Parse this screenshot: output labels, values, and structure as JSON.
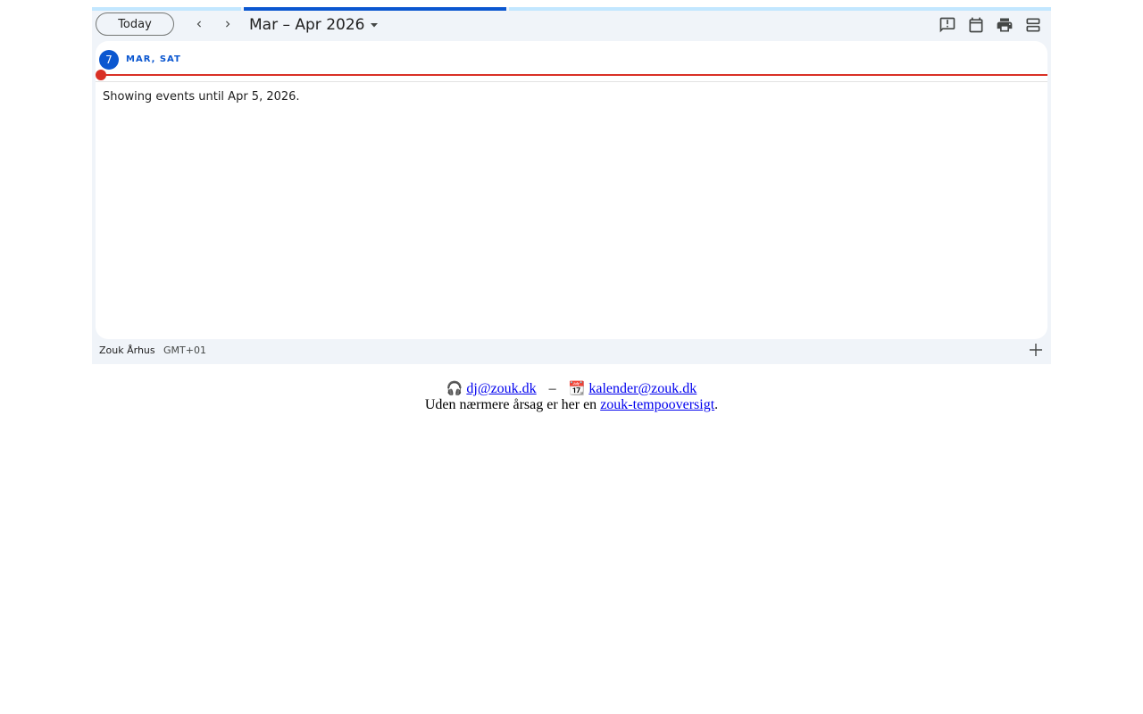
{
  "toolbar": {
    "today_label": "Today",
    "range_title": "Mar – Apr 2026",
    "icons": [
      "chevron-left-icon",
      "chevron-right-icon",
      "dropdown-caret-icon",
      "feedback-icon",
      "calendar-icon",
      "print-icon",
      "agenda-view-icon"
    ]
  },
  "agenda": {
    "day_number": "7",
    "day_label": "MAR, SAT",
    "until_text": "Showing events until Apr 5, 2026."
  },
  "footer": {
    "calendar_name": "Zouk Århus",
    "timezone": "GMT+01"
  },
  "contact": {
    "dj_icon": "🎧",
    "dj_email": "dj@zouk.dk",
    "separator": "–",
    "calendar_icon": "📆",
    "calendar_email": "kalender@zouk.dk",
    "note_prefix": "Uden nærmere årsag er her en ",
    "note_link": "zouk-tempooversigt",
    "note_suffix": "."
  },
  "colors": {
    "accent": "#0b57d0",
    "now_line": "#d93025",
    "progress_track": "#c2e7ff",
    "surface": "#f0f4f9",
    "link": "#0000ee"
  }
}
